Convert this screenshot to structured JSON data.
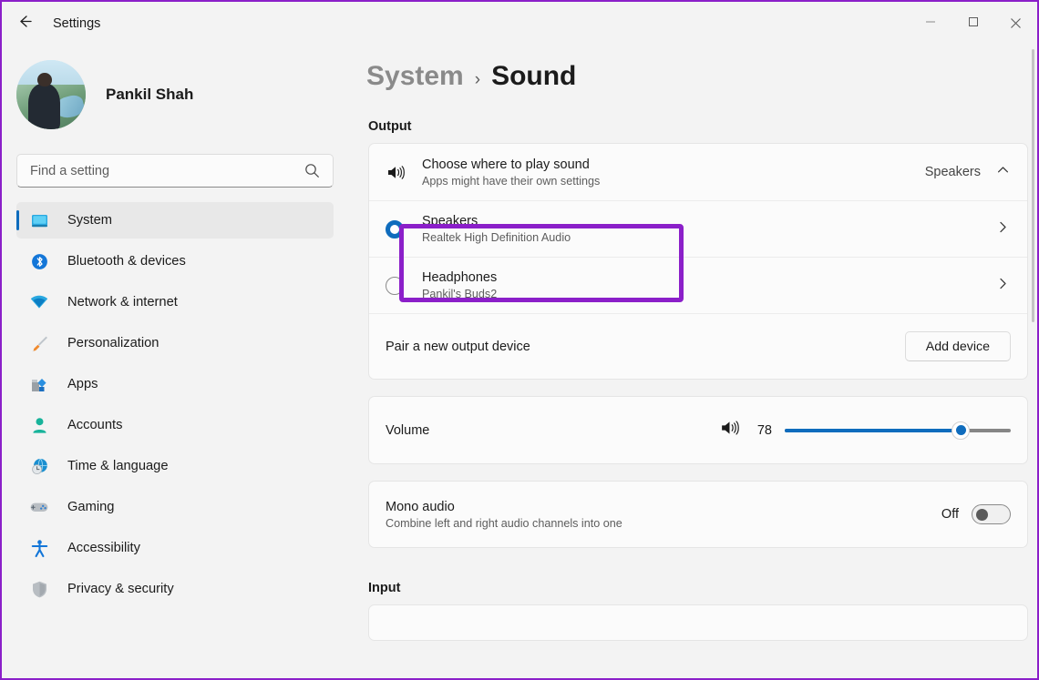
{
  "window": {
    "title": "Settings",
    "back_icon": "arrow-left-icon",
    "controls": [
      {
        "name": "minimize",
        "glyph": "minimize-icon"
      },
      {
        "name": "maximize",
        "glyph": "maximize-icon"
      },
      {
        "name": "close",
        "glyph": "close-icon"
      }
    ]
  },
  "sidebar": {
    "profile": {
      "name": "Pankil Shah",
      "avatar_alt": "user-avatar"
    },
    "search": {
      "placeholder": "Find a setting",
      "value": "",
      "icon": "search-icon"
    },
    "items": [
      {
        "label": "System",
        "icon": "monitor-icon",
        "active": true
      },
      {
        "label": "Bluetooth & devices",
        "icon": "bluetooth-icon",
        "active": false
      },
      {
        "label": "Network & internet",
        "icon": "wifi-icon",
        "active": false
      },
      {
        "label": "Personalization",
        "icon": "paintbrush-icon",
        "active": false
      },
      {
        "label": "Apps",
        "icon": "apps-icon",
        "active": false
      },
      {
        "label": "Accounts",
        "icon": "person-icon",
        "active": false
      },
      {
        "label": "Time & language",
        "icon": "clock-globe-icon",
        "active": false
      },
      {
        "label": "Gaming",
        "icon": "gamepad-icon",
        "active": false
      },
      {
        "label": "Accessibility",
        "icon": "accessibility-icon",
        "active": false
      },
      {
        "label": "Privacy & security",
        "icon": "shield-icon",
        "active": false
      }
    ]
  },
  "main": {
    "breadcrumb": {
      "parent": "System",
      "separator": "›",
      "current": "Sound"
    },
    "output": {
      "section_label": "Output",
      "chooser": {
        "icon": "speaker-icon",
        "title": "Choose where to play sound",
        "subtitle": "Apps might have their own settings",
        "value": "Speakers",
        "expand_icon": "chevron-up-icon"
      },
      "devices": [
        {
          "name": "Speakers",
          "detail": "Realtek High Definition Audio",
          "selected": true,
          "chevron": "chevron-right-icon",
          "highlighted": true
        },
        {
          "name": "Headphones",
          "detail": "Pankil's Buds2",
          "selected": false,
          "chevron": "chevron-right-icon",
          "highlighted": false
        }
      ],
      "pair": {
        "label": "Pair a new output device",
        "button": "Add device"
      }
    },
    "volume": {
      "label": "Volume",
      "icon": "speaker-icon",
      "value": "78",
      "percent": 78,
      "min": 0,
      "max": 100
    },
    "mono_audio": {
      "title": "Mono audio",
      "subtitle": "Combine left and right audio channels into one",
      "state_label": "Off",
      "on": false
    },
    "input": {
      "section_label": "Input"
    }
  },
  "colors": {
    "accent": "#0f6cbd",
    "annotation": "#8b1fc9",
    "app_background": "#f3f3f3",
    "card_background": "#fbfbfb"
  }
}
